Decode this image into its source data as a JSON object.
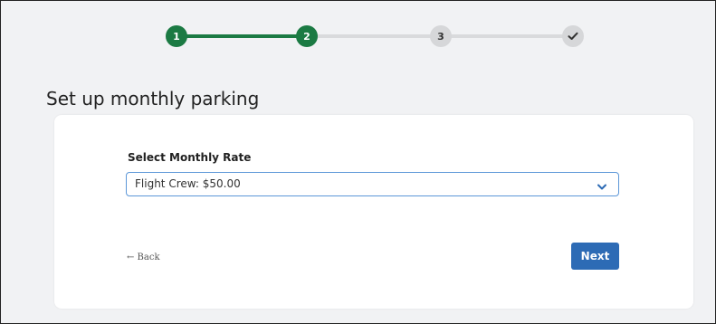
{
  "stepper": {
    "steps": [
      {
        "label": "1",
        "state": "complete"
      },
      {
        "label": "2",
        "state": "current"
      },
      {
        "label": "3",
        "state": "upcoming"
      },
      {
        "label": "",
        "state": "upcoming",
        "icon": "check-icon"
      }
    ],
    "colors": {
      "complete": "#1b7a43",
      "upcoming": "#d6d7d9"
    }
  },
  "page": {
    "title": "Set up monthly parking"
  },
  "form": {
    "rate_label": "Select Monthly Rate",
    "rate_selected": "Flight Crew: $50.00",
    "back_label": "← Back",
    "next_label": "Next"
  },
  "colors": {
    "accent": "#2d6bb5",
    "select_border": "#5c97d8",
    "background": "#f1f2f4"
  }
}
